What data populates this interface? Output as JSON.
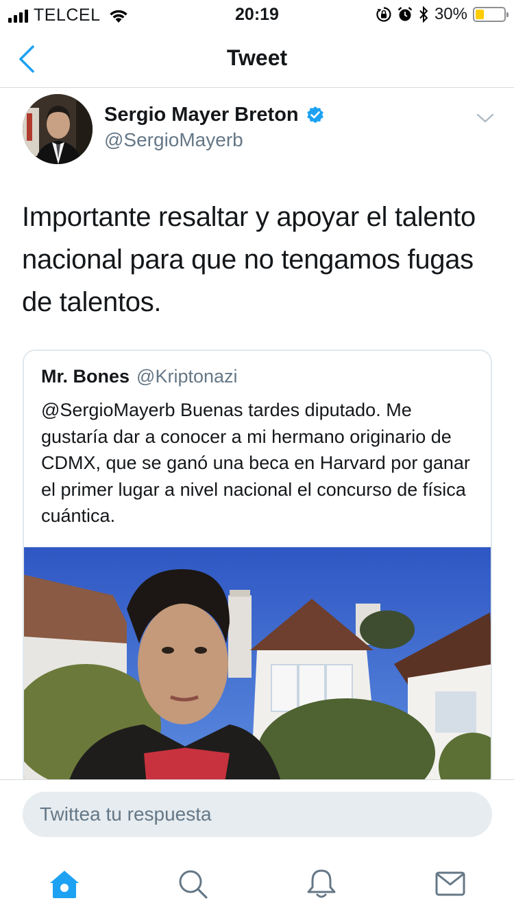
{
  "status_bar": {
    "carrier": "TELCEL",
    "time": "20:19",
    "battery_percent": "30%",
    "battery_level": 0.3,
    "icons": [
      "signal-icon",
      "wifi-icon",
      "orientation-lock-icon",
      "alarm-icon",
      "bluetooth-icon",
      "battery-icon"
    ]
  },
  "nav": {
    "title": "Tweet",
    "back_icon": "chevron-left-icon"
  },
  "tweet": {
    "author_name": "Sergio Mayer Breton",
    "author_handle": "@SergioMayerb",
    "verified": true,
    "text": "Importante resaltar y apoyar el talento nacional para que no tengamos fugas de talentos."
  },
  "quoted_tweet": {
    "author_name": "Mr. Bones",
    "author_handle": "@Kriptonazi",
    "text": "@SergioMayerb Buenas tardes diputado. Me gustaría dar a conocer a mi hermano originario de CDMX, que se ganó una beca en Harvard por ganar el primer lugar a nivel nacional el concurso de física cuántica."
  },
  "reply": {
    "placeholder": "Twittea tu respuesta"
  },
  "tabs": [
    {
      "name": "home",
      "icon": "home-icon",
      "active": true
    },
    {
      "name": "search",
      "icon": "search-icon",
      "active": false
    },
    {
      "name": "notifications",
      "icon": "bell-icon",
      "active": false
    },
    {
      "name": "messages",
      "icon": "mail-icon",
      "active": false
    }
  ],
  "colors": {
    "accent": "#1da1f2",
    "secondary_text": "#657786",
    "border": "#e1e8ed"
  }
}
